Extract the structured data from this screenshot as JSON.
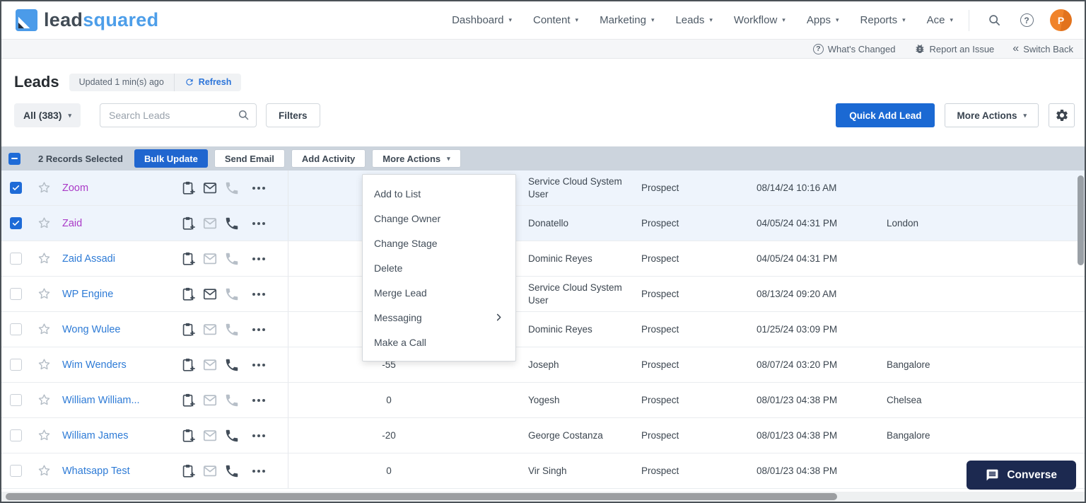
{
  "brand": {
    "name_part1": "lead",
    "name_part2": "squared"
  },
  "nav": {
    "items": [
      {
        "label": "Dashboard"
      },
      {
        "label": "Content"
      },
      {
        "label": "Marketing"
      },
      {
        "label": "Leads"
      },
      {
        "label": "Workflow"
      },
      {
        "label": "Apps"
      },
      {
        "label": "Reports"
      },
      {
        "label": "Ace"
      }
    ],
    "avatar_initial": "P"
  },
  "utility": {
    "whats_changed": "What's Changed",
    "report_issue": "Report an Issue",
    "switch_back": "Switch Back"
  },
  "header": {
    "title": "Leads",
    "updated": "Updated 1 min(s) ago",
    "refresh": "Refresh"
  },
  "toolbar": {
    "view_selector": "All (383)",
    "search_placeholder": "Search Leads",
    "filters": "Filters",
    "quick_add": "Quick Add Lead",
    "more_actions": "More Actions"
  },
  "bulkbar": {
    "selected_text": "2 Records Selected",
    "bulk_update": "Bulk Update",
    "send_email": "Send Email",
    "add_activity": "Add Activity",
    "more_actions": "More Actions"
  },
  "context_menu": {
    "items": [
      "Add to List",
      "Change Owner",
      "Change Stage",
      "Delete",
      "Merge Lead",
      "Messaging",
      "Make a Call"
    ]
  },
  "table": {
    "rows": [
      {
        "name": "Zoom",
        "checked": true,
        "visited": true,
        "mail": "dark",
        "phone": "light",
        "score": "",
        "owner": "Service Cloud System User",
        "stage": "Prospect",
        "modified": "08/14/24 10:16 AM",
        "city": ""
      },
      {
        "name": "Zaid",
        "checked": true,
        "visited": true,
        "mail": "light",
        "phone": "dark",
        "score": "",
        "owner": "Donatello",
        "stage": "Prospect",
        "modified": "04/05/24 04:31 PM",
        "city": "London"
      },
      {
        "name": "Zaid Assadi",
        "checked": false,
        "visited": false,
        "mail": "light",
        "phone": "light",
        "score": "",
        "owner": "Dominic Reyes",
        "stage": "Prospect",
        "modified": "04/05/24 04:31 PM",
        "city": ""
      },
      {
        "name": "WP Engine",
        "checked": false,
        "visited": false,
        "mail": "dark",
        "phone": "light",
        "score": "",
        "owner": "Service Cloud System User",
        "stage": "Prospect",
        "modified": "08/13/24 09:20 AM",
        "city": ""
      },
      {
        "name": "Wong Wulee",
        "checked": false,
        "visited": false,
        "mail": "light",
        "phone": "light",
        "score": "",
        "owner": "Dominic Reyes",
        "stage": "Prospect",
        "modified": "01/25/24 03:09 PM",
        "city": ""
      },
      {
        "name": "Wim Wenders",
        "checked": false,
        "visited": false,
        "mail": "light",
        "phone": "dark",
        "score": "-55",
        "owner": "Joseph",
        "stage": "Prospect",
        "modified": "08/07/24 03:20 PM",
        "city": "Bangalore"
      },
      {
        "name": "William William...",
        "checked": false,
        "visited": false,
        "mail": "light",
        "phone": "light",
        "score": "0",
        "owner": "Yogesh",
        "stage": "Prospect",
        "modified": "08/01/23 04:38 PM",
        "city": "Chelsea"
      },
      {
        "name": "William James",
        "checked": false,
        "visited": false,
        "mail": "light",
        "phone": "dark",
        "score": "-20",
        "owner": "George Costanza",
        "stage": "Prospect",
        "modified": "08/01/23 04:38 PM",
        "city": "Bangalore"
      },
      {
        "name": "Whatsapp Test",
        "checked": false,
        "visited": false,
        "mail": "light",
        "phone": "dark",
        "score": "0",
        "owner": "Vir Singh",
        "stage": "Prospect",
        "modified": "08/01/23 04:38 PM",
        "city": ""
      }
    ]
  },
  "converse": {
    "label": "Converse"
  },
  "colors": {
    "accent_blue": "#1b69d3",
    "link_blue": "#2e7bd6",
    "link_visited": "#aa3ac7",
    "selected_row_bg": "#eef4fc",
    "bulkbar_bg": "#ccd4dd",
    "converse_navy": "#1c2950",
    "avatar_orange": "#ee7f25"
  }
}
